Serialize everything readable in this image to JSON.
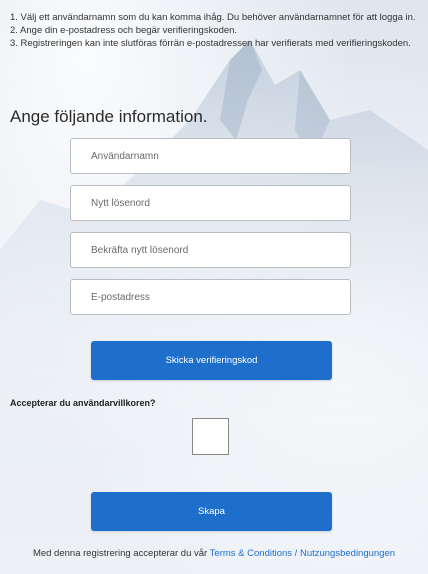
{
  "instructions": {
    "line1": "1. Välj ett användarnamn som du kan komma ihåg. Du behöver användarnamnet för att logga in.",
    "line2": "2. Ange din e-postadress och begär verifieringskoden.",
    "line3": "3. Registreringen kan inte slutföras förrän e-postadressen har verifierats med verifieringskoden."
  },
  "heading": "Ange följande information.",
  "fields": {
    "username_placeholder": "Användarnamn",
    "new_password_placeholder": "Nytt lösenord",
    "confirm_password_placeholder": "Bekräfta nytt lösenord",
    "email_placeholder": "E-postadress"
  },
  "buttons": {
    "send_code": "Skicka verifieringskod",
    "create": "Skapa"
  },
  "terms": {
    "question": "Accepterar du användarvillkoren?",
    "accepted": false
  },
  "footer": {
    "text": "Med denna registrering accepterar du vår ",
    "link": "Terms & Conditions / Nutzungsbedingungen"
  },
  "colors": {
    "primary": "#1e6fcc",
    "link": "#1e6fcc"
  }
}
